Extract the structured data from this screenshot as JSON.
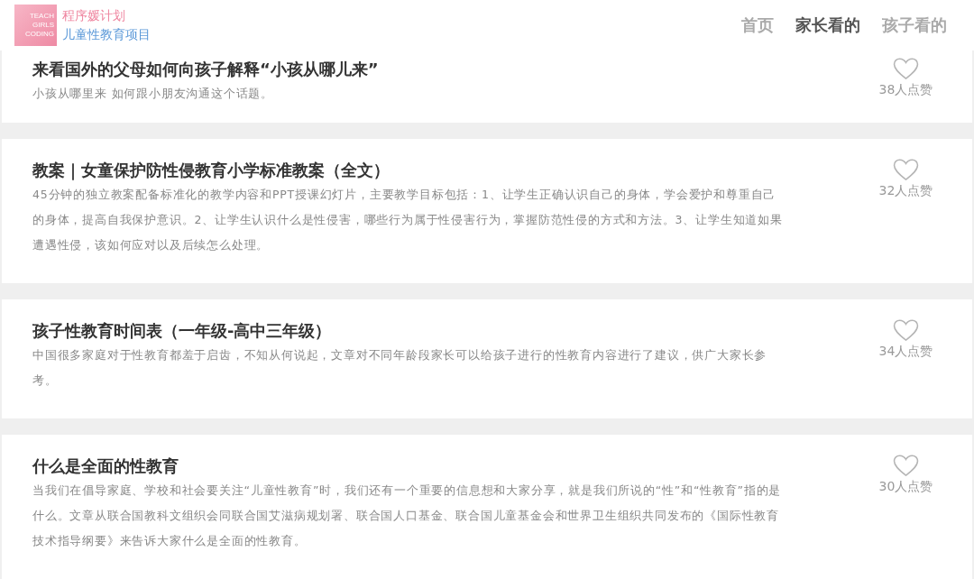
{
  "header": {
    "logo": {
      "lines": [
        "TEACH",
        "GIRLS",
        "CODING"
      ]
    },
    "title": "程序媛计划",
    "subtitle": "儿童性教育项目"
  },
  "nav": [
    {
      "label": "首页",
      "selected": false
    },
    {
      "label": "家长看的",
      "selected": true
    },
    {
      "label": "孩子看的",
      "selected": false
    }
  ],
  "articles": [
    {
      "title": "来看国外的父母如何向孩子解释“小孩从哪儿来”",
      "summary": "小孩从哪里来 如何跟小朋友沟通这个话题。",
      "likes": "38人点赞"
    },
    {
      "title": "教案｜女童保护防性侵教育小学标准教案（全文）",
      "summary": "45分钟的独立教案配备标准化的教学内容和PPT授课幻灯片，主要教学目标包括：1、让学生正确认识自己的身体，学会爱护和尊重自己的身体，提高自我保护意识。2、让学生认识什么是性侵害，哪些行为属于性侵害行为，掌握防范性侵的方式和方法。3、让学生知道如果遭遇性侵，该如何应对以及后续怎么处理。",
      "likes": "32人点赞"
    },
    {
      "title": "孩子性教育时间表（一年级-高中三年级）",
      "summary": "中国很多家庭对于性教育都羞于启齿，不知从何说起，文章对不同年龄段家长可以给孩子进行的性教育内容进行了建议，供广大家长参考。",
      "likes": "34人点赞"
    },
    {
      "title": "什么是全面的性教育",
      "summary": "当我们在倡导家庭、学校和社会要关注“儿童性教育”时，我们还有一个重要的信息想和大家分享，就是我们所说的“性”和“性教育”指的是什么。文章从联合国教科文组织会同联合国艾滋病规划署、联合国人口基金、联合国儿童基金会和世界卫生组织共同发布的《国际性教育技术指导纲要》来告诉大家什么是全面的性教育。",
      "likes": "30人点赞"
    }
  ]
}
